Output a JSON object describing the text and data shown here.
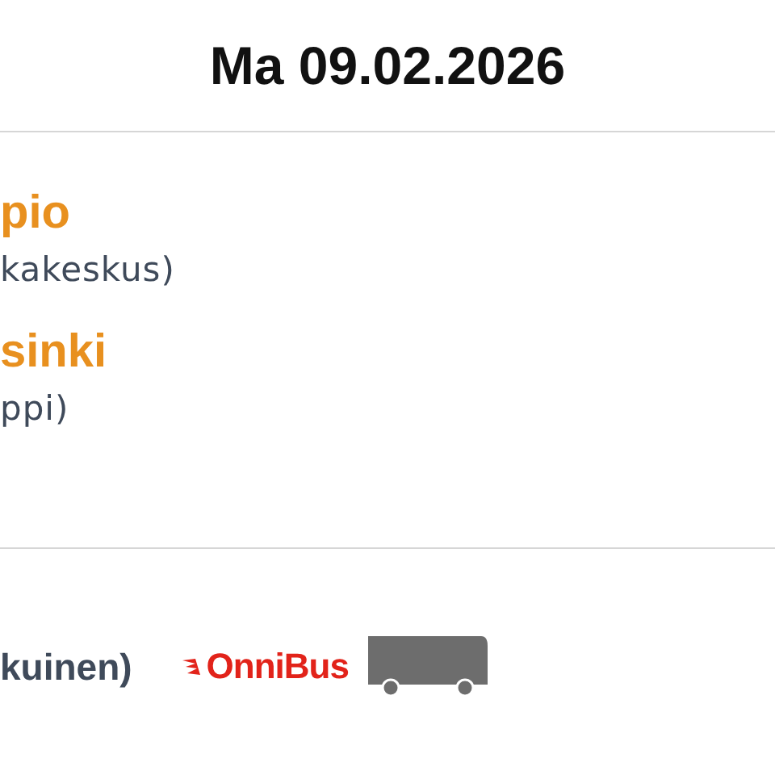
{
  "header": {
    "date": "Ma 09.02.2026"
  },
  "stops": [
    {
      "city": "pio",
      "place": "kakeskus)"
    },
    {
      "city": "sinki",
      "place": "ppi)"
    }
  ],
  "operator": {
    "label": "kuinen)",
    "brand": "OnniBus"
  }
}
